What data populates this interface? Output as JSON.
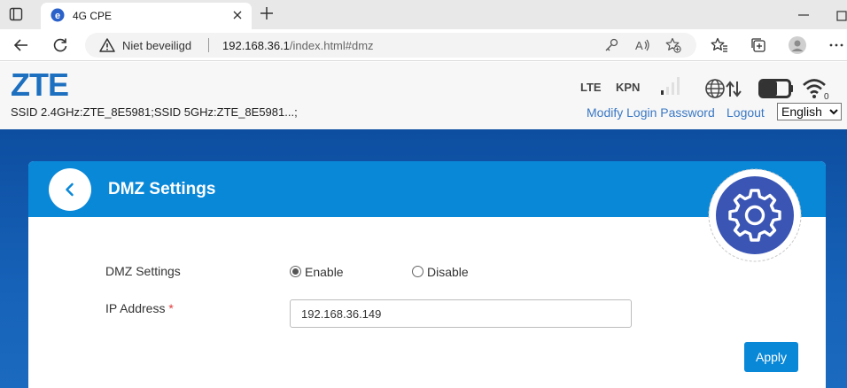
{
  "browser": {
    "tab_title": "4G CPE",
    "security_text": "Niet beveiligd",
    "url_host": "192.168.36.1",
    "url_path": "/index.html#dmz"
  },
  "router": {
    "logo": "ZTE",
    "ssid": "SSID 2.4GHz:ZTE_8E5981;SSID 5GHz:ZTE_8E5981...;",
    "network_type": "LTE",
    "operator": "KPN",
    "wifi_clients": "0",
    "modify_password_label": "Modify Login Password",
    "logout_label": "Logout",
    "language": "English"
  },
  "dmz": {
    "title": "DMZ Settings",
    "settings_label": "DMZ Settings",
    "enable_label": "Enable",
    "disable_label": "Disable",
    "selected": "Enable",
    "ip_label": "IP Address",
    "required_mark": "*",
    "ip_value": "192.168.36.149",
    "apply_label": "Apply"
  },
  "colors": {
    "brand_blue": "#1d6fbf",
    "header_blue": "#0a88d8",
    "page_blue": "#0d4ea0",
    "link_blue": "#3a78c4"
  },
  "icons": [
    "window-menu-icon",
    "tab-favicon-icon",
    "close-icon",
    "plus-icon",
    "minimize-icon",
    "restore-icon",
    "back-arrow-icon",
    "refresh-icon",
    "warning-icon",
    "key-icon",
    "read-aloud-icon",
    "add-favorite-icon",
    "favorites-icon",
    "collections-icon",
    "profile-icon",
    "more-icon",
    "signal-icon",
    "globe-transfer-icon",
    "battery-icon",
    "wifi-icon",
    "chevron-left-icon",
    "gear-icon"
  ]
}
